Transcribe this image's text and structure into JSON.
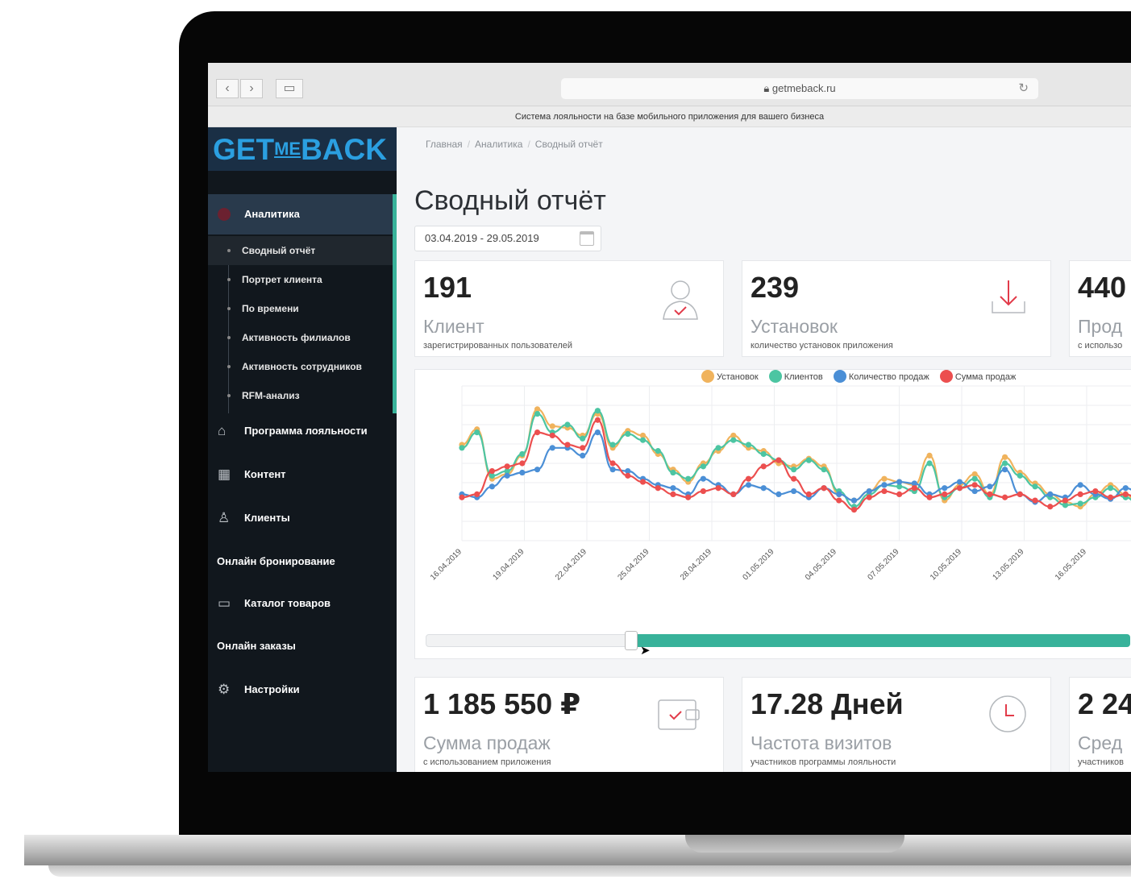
{
  "browser": {
    "url": "getmeback.ru",
    "tagline": "Система лояльности на базе мобильного приложения для вашего бизнеса"
  },
  "logo": {
    "part1": "GET",
    "part2": "ME",
    "part3": "BACK"
  },
  "sidebar": {
    "analytics_label": "Аналитика",
    "sub_items": [
      "Сводный отчёт",
      "Портрет клиента",
      "По времени",
      "Активность филиалов",
      "Активность сотрудников",
      "RFM-анализ"
    ],
    "main_items": [
      {
        "label": "Программа лояльности",
        "icon": "home-icon"
      },
      {
        "label": "Контент",
        "icon": "content-icon"
      },
      {
        "label": "Клиенты",
        "icon": "user-icon"
      },
      {
        "label": "Онлайн бронирование",
        "icon": ""
      },
      {
        "label": "Каталог товаров",
        "icon": "book-icon"
      },
      {
        "label": "Онлайн заказы",
        "icon": ""
      },
      {
        "label": "Настройки",
        "icon": "gear-icon"
      }
    ]
  },
  "breadcrumb": [
    "Главная",
    "Аналитика",
    "Сводный отчёт"
  ],
  "page_title": "Сводный отчёт",
  "date_range": "03.04.2019 - 29.05.2019",
  "cards_top": [
    {
      "value": "191",
      "label": "Клиент",
      "sub": "зарегистрированных пользователей",
      "icon": "user-check-icon"
    },
    {
      "value": "239",
      "label": "Установок",
      "sub": "количество установок приложения",
      "icon": "download-icon"
    },
    {
      "value": "440",
      "label": "Прод",
      "sub": "с использо",
      "icon": ""
    }
  ],
  "cards_bottom": [
    {
      "value": "1 185 550 ₽",
      "label": "Сумма продаж",
      "sub": "с использованием приложения",
      "icon": "wallet-icon"
    },
    {
      "value": "17.28 Дней",
      "label": "Частота визитов",
      "sub": "участников программы лояльности",
      "icon": "clock-icon"
    },
    {
      "value": "2 24",
      "label": "Сред",
      "sub": "участников",
      "icon": ""
    }
  ],
  "colors": {
    "accent": "#38b29a",
    "installs": "#f0b35d",
    "clients": "#4cc5a2",
    "sales_count": "#4b8fd6",
    "sales_sum": "#ec4f4f"
  },
  "chart_data": {
    "type": "line",
    "x_ticks": [
      "16.04.2019",
      "19.04.2019",
      "22.04.2019",
      "25.04.2019",
      "28.04.2019",
      "01.05.2019",
      "04.05.2019",
      "07.05.2019",
      "10.05.2019",
      "13.05.2019",
      "16.05.2019",
      "19.0"
    ],
    "series": [
      {
        "name": "Установок",
        "color": "#f0b35d",
        "values": [
          0.62,
          0.72,
          0.4,
          0.43,
          0.55,
          0.85,
          0.74,
          0.73,
          0.68,
          0.82,
          0.6,
          0.71,
          0.68,
          0.56,
          0.46,
          0.38,
          0.5,
          0.58,
          0.68,
          0.6,
          0.58,
          0.5,
          0.48,
          0.53,
          0.48,
          0.3,
          0.26,
          0.32,
          0.4,
          0.38,
          0.36,
          0.55,
          0.26,
          0.36,
          0.43,
          0.3,
          0.54,
          0.44,
          0.37,
          0.3,
          0.25,
          0.22,
          0.3,
          0.36,
          0.3,
          0.2
        ]
      },
      {
        "name": "Клиентов",
        "color": "#4cc5a2",
        "values": [
          0.6,
          0.7,
          0.42,
          0.45,
          0.56,
          0.82,
          0.7,
          0.75,
          0.66,
          0.84,
          0.62,
          0.69,
          0.65,
          0.58,
          0.44,
          0.4,
          0.48,
          0.6,
          0.65,
          0.62,
          0.56,
          0.52,
          0.46,
          0.52,
          0.46,
          0.32,
          0.22,
          0.3,
          0.36,
          0.35,
          0.32,
          0.5,
          0.28,
          0.34,
          0.4,
          0.28,
          0.5,
          0.42,
          0.35,
          0.28,
          0.23,
          0.24,
          0.28,
          0.34,
          0.28,
          0.22
        ]
      },
      {
        "name": "Количество продаж",
        "color": "#4b8fd6",
        "values": [
          0.3,
          0.28,
          0.35,
          0.42,
          0.44,
          0.46,
          0.6,
          0.6,
          0.55,
          0.7,
          0.46,
          0.45,
          0.4,
          0.36,
          0.34,
          0.3,
          0.4,
          0.36,
          0.3,
          0.36,
          0.34,
          0.3,
          0.32,
          0.28,
          0.34,
          0.3,
          0.26,
          0.32,
          0.36,
          0.38,
          0.37,
          0.3,
          0.34,
          0.38,
          0.32,
          0.35,
          0.46,
          0.3,
          0.25,
          0.3,
          0.28,
          0.36,
          0.3,
          0.27,
          0.34,
          0.3
        ]
      },
      {
        "name": "Сумма продаж",
        "color": "#ec4f4f",
        "values": [
          0.28,
          0.3,
          0.45,
          0.48,
          0.5,
          0.7,
          0.68,
          0.62,
          0.6,
          0.78,
          0.5,
          0.42,
          0.38,
          0.34,
          0.3,
          0.28,
          0.32,
          0.34,
          0.3,
          0.4,
          0.48,
          0.52,
          0.4,
          0.3,
          0.34,
          0.26,
          0.2,
          0.28,
          0.32,
          0.3,
          0.34,
          0.28,
          0.3,
          0.34,
          0.36,
          0.3,
          0.28,
          0.3,
          0.26,
          0.22,
          0.26,
          0.3,
          0.32,
          0.28,
          0.3,
          0.26
        ]
      }
    ]
  }
}
